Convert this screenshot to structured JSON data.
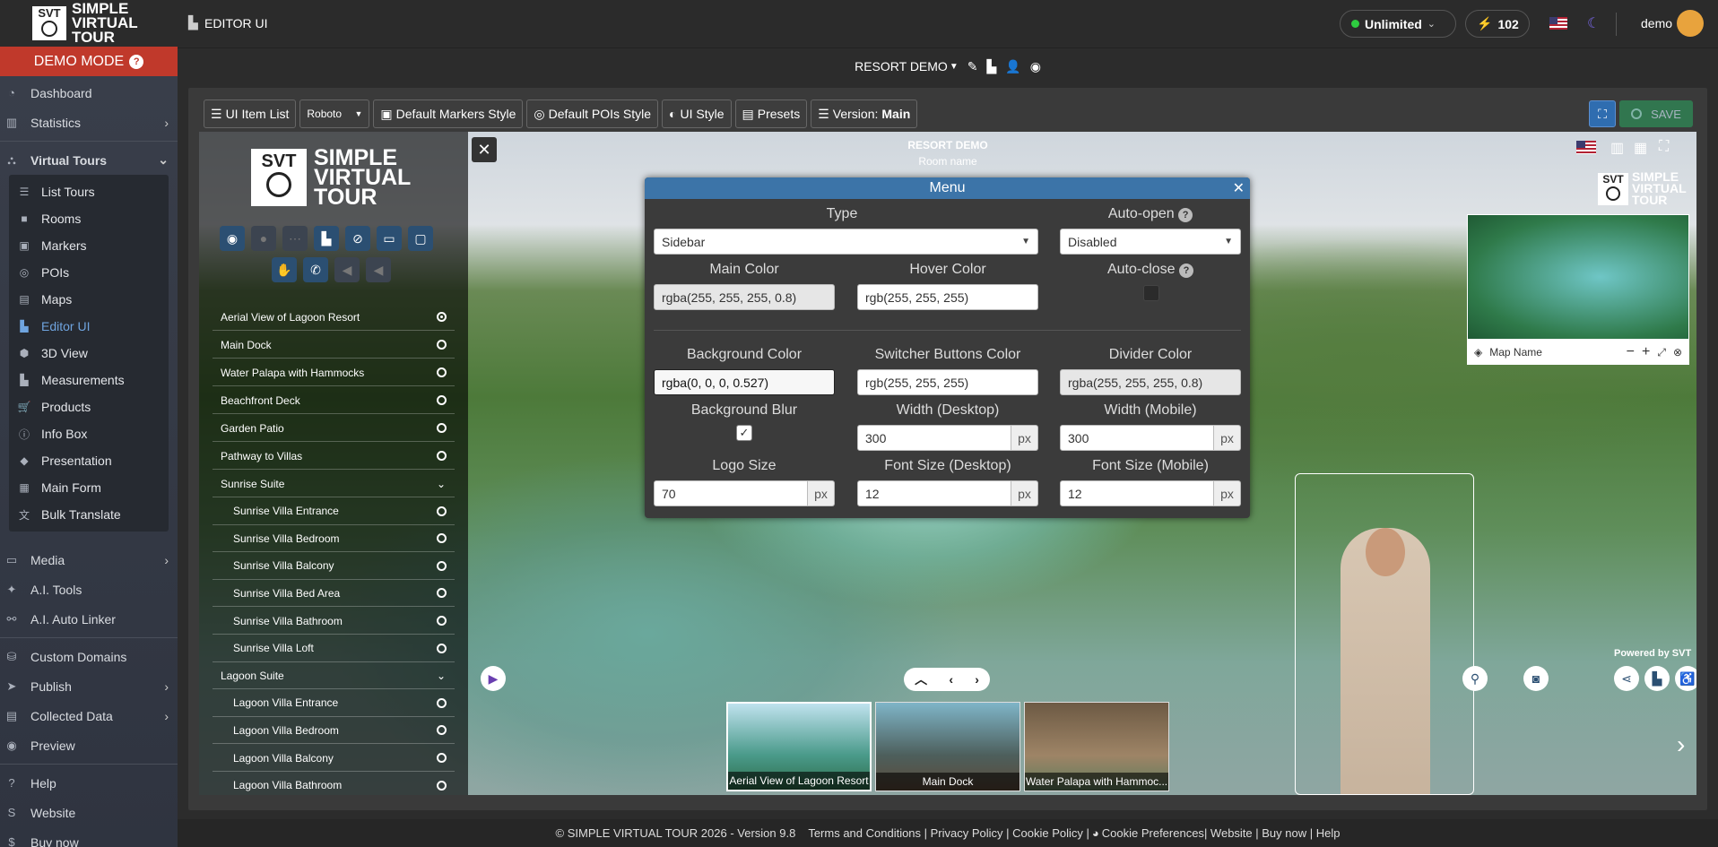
{
  "brand": {
    "logo_mark": "SVT",
    "logo_text_1": "SIMPLE",
    "logo_text_2": "VIRTUAL",
    "logo_text_3": "TOUR"
  },
  "demo_mode": {
    "label": "DEMO MODE",
    "help": "?"
  },
  "sidebar": {
    "items_top": [
      {
        "label": "Dashboard",
        "icon": "dashboard-icon"
      },
      {
        "label": "Statistics",
        "icon": "chart-icon"
      }
    ],
    "virtual_tours": {
      "label": "Virtual Tours",
      "icon": "tours-icon"
    },
    "tour_items": [
      {
        "label": "List Tours",
        "icon": "list-icon"
      },
      {
        "label": "Rooms",
        "icon": "rooms-icon"
      },
      {
        "label": "Markers",
        "icon": "markers-icon"
      },
      {
        "label": "POIs",
        "icon": "pois-icon"
      },
      {
        "label": "Maps",
        "icon": "maps-icon"
      },
      {
        "label": "Editor UI",
        "icon": "editor-ui-icon"
      },
      {
        "label": "3D View",
        "icon": "3d-view-icon"
      },
      {
        "label": "Measurements",
        "icon": "measurements-icon"
      },
      {
        "label": "Products",
        "icon": "cart-icon"
      },
      {
        "label": "Info Box",
        "icon": "info-icon"
      },
      {
        "label": "Presentation",
        "icon": "presentation-icon"
      },
      {
        "label": "Main Form",
        "icon": "form-icon"
      },
      {
        "label": "Bulk Translate",
        "icon": "translate-icon"
      }
    ],
    "items_bottom": [
      {
        "label": "Media",
        "icon": "media-icon",
        "chevron": true
      },
      {
        "label": "A.I. Tools",
        "icon": "ai-icon",
        "chevron": false
      },
      {
        "label": "A.I. Auto Linker",
        "icon": "linker-icon",
        "chevron": false
      },
      {
        "label": "Custom Domains",
        "icon": "domains-icon",
        "chevron": false
      },
      {
        "label": "Publish",
        "icon": "publish-icon",
        "chevron": true
      },
      {
        "label": "Collected Data",
        "icon": "database-icon",
        "chevron": true
      },
      {
        "label": "Preview",
        "icon": "eye-icon",
        "chevron": false
      },
      {
        "label": "Help",
        "icon": "help-icon",
        "chevron": false
      },
      {
        "label": "Website",
        "icon": "website-icon",
        "chevron": false
      },
      {
        "label": "Buy now",
        "icon": "buy-icon",
        "chevron": false
      }
    ]
  },
  "topbar": {
    "page_title": "EDITOR UI",
    "plan": "Unlimited",
    "credits": "102",
    "user": "demo"
  },
  "tourbar": {
    "tour_name": "RESORT DEMO"
  },
  "toolbar": {
    "ui_item_list": "UI Item List",
    "font": "Roboto",
    "markers_style": "Default Markers Style",
    "pois_style": "Default POIs Style",
    "ui_style": "UI Style",
    "presets": "Presets",
    "version_label": "Version:",
    "version_value": "Main",
    "save": "SAVE"
  },
  "viewer": {
    "tour_title": "RESORT DEMO",
    "room_name": "Room name",
    "map_name": "Map Name",
    "powered_by": "Powered by SVT",
    "rooms": [
      {
        "label": "Aerial View of Lagoon Resort",
        "type": "room",
        "selected": true
      },
      {
        "label": "Main Dock",
        "type": "room"
      },
      {
        "label": "Water Palapa with Hammocks",
        "type": "room"
      },
      {
        "label": "Beachfront Deck",
        "type": "room"
      },
      {
        "label": "Garden Patio",
        "type": "room"
      },
      {
        "label": "Pathway to Villas",
        "type": "room"
      },
      {
        "label": "Sunrise Suite",
        "type": "group"
      },
      {
        "label": "Sunrise Villa Entrance",
        "type": "sub"
      },
      {
        "label": "Sunrise Villa Bedroom",
        "type": "sub"
      },
      {
        "label": "Sunrise Villa Balcony",
        "type": "sub"
      },
      {
        "label": "Sunrise Villa Bed Area",
        "type": "sub"
      },
      {
        "label": "Sunrise Villa Bathroom",
        "type": "sub"
      },
      {
        "label": "Sunrise Villa Loft",
        "type": "sub"
      },
      {
        "label": "Lagoon Suite",
        "type": "group"
      },
      {
        "label": "Lagoon Villa Entrance",
        "type": "sub"
      },
      {
        "label": "Lagoon Villa Bedroom",
        "type": "sub"
      },
      {
        "label": "Lagoon Villa Balcony",
        "type": "sub"
      },
      {
        "label": "Lagoon Villa Bathroom",
        "type": "sub"
      }
    ],
    "thumbnails": [
      {
        "label": "Aerial View of Lagoon Resort"
      },
      {
        "label": "Main Dock"
      },
      {
        "label": "Water Palapa with Hammoc..."
      }
    ]
  },
  "menu_modal": {
    "title": "Menu",
    "type_label": "Type",
    "type_value": "Sidebar",
    "auto_open_label": "Auto-open",
    "auto_open_value": "Disabled",
    "main_color_label": "Main Color",
    "main_color_value": "rgba(255, 255, 255, 0.8)",
    "hover_color_label": "Hover Color",
    "hover_color_value": "rgb(255, 255, 255)",
    "auto_close_label": "Auto-close",
    "bg_color_label": "Background Color",
    "bg_color_value": "rgba(0, 0, 0, 0.527)",
    "switcher_color_label": "Switcher Buttons Color",
    "switcher_color_value": "rgb(255, 255, 255)",
    "divider_color_label": "Divider Color",
    "divider_color_value": "rgba(255, 255, 255, 0.8)",
    "bg_blur_label": "Background Blur",
    "width_desktop_label": "Width (Desktop)",
    "width_desktop_value": "300",
    "width_mobile_label": "Width (Mobile)",
    "width_mobile_value": "300",
    "logo_size_label": "Logo Size",
    "logo_size_value": "70",
    "font_desktop_label": "Font Size (Desktop)",
    "font_desktop_value": "12",
    "font_mobile_label": "Font Size (Mobile)",
    "font_mobile_value": "12",
    "unit": "px"
  },
  "footer": {
    "copyright": "© SIMPLE VIRTUAL TOUR 2026 - Version 9.8",
    "links": "Terms and Conditions | Privacy Policy | Cookie Policy | ",
    "cookie_prefs": "Cookie Preferences",
    "links2": " | Website | Buy now | Help"
  },
  "colors": {
    "accent": "#3c74a8",
    "demo": "#c0392b",
    "save": "#2e8b57"
  }
}
